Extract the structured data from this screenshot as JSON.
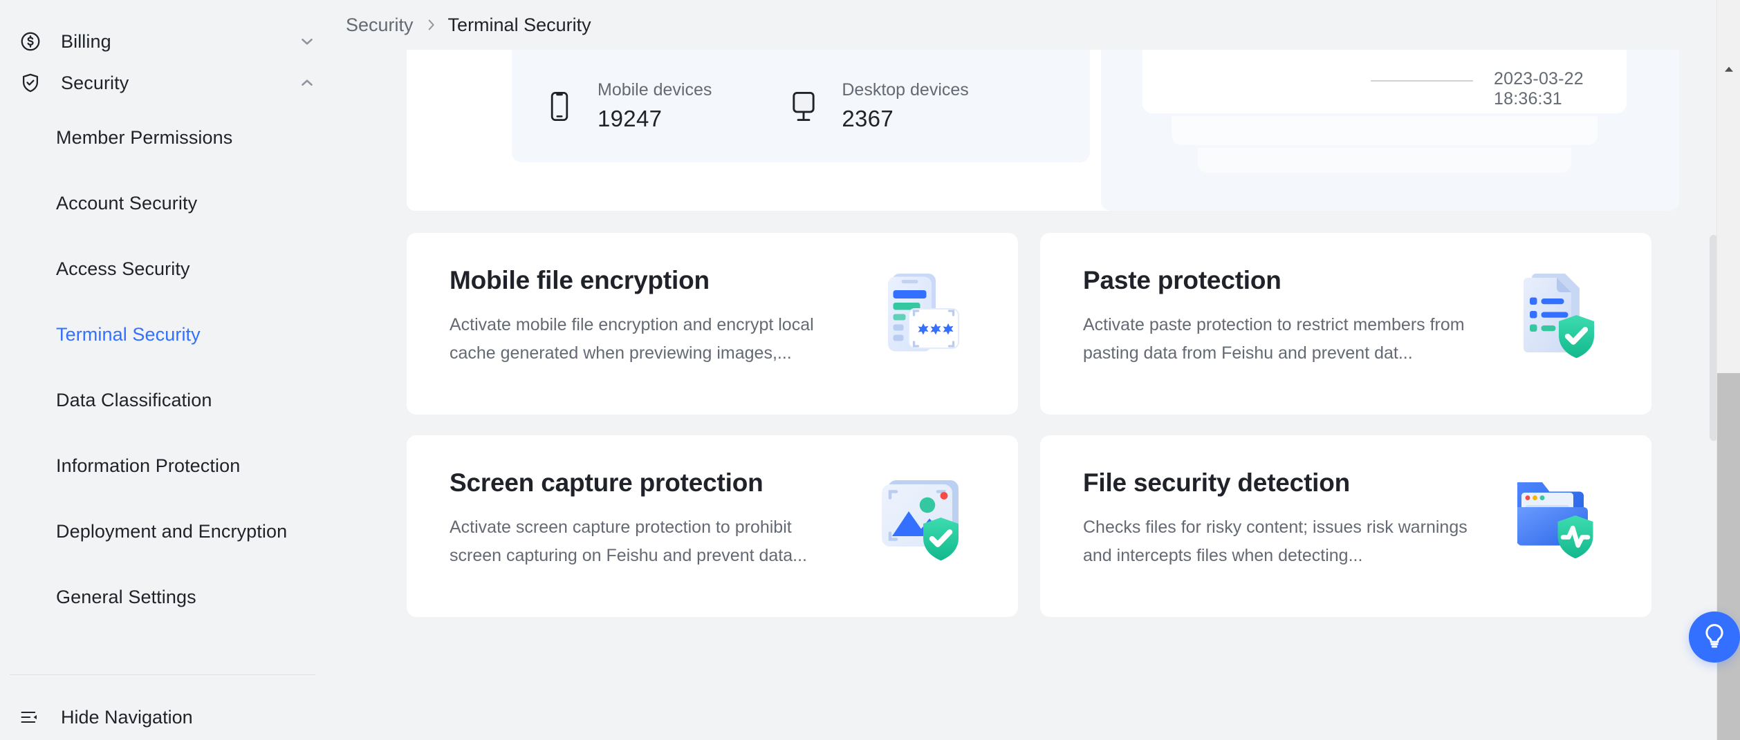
{
  "sidebar": {
    "groups": [
      {
        "label": "Billing",
        "icon": "dollar-circle-icon",
        "expanded": false,
        "chevron": "chevron-down-icon"
      },
      {
        "label": "Security",
        "icon": "shield-check-icon",
        "expanded": true,
        "chevron": "chevron-up-icon"
      }
    ],
    "items": [
      {
        "label": "Member Permissions",
        "active": false
      },
      {
        "label": "Account Security",
        "active": false
      },
      {
        "label": "Access Security",
        "active": false
      },
      {
        "label": "Terminal Security",
        "active": true
      },
      {
        "label": "Data Classification",
        "active": false
      },
      {
        "label": "Information Protection",
        "active": false
      },
      {
        "label": "Deployment and Encryption",
        "active": false
      },
      {
        "label": "General Settings",
        "active": false
      }
    ],
    "hide_navigation": {
      "label": "Hide Navigation",
      "icon": "collapse-panel-icon"
    }
  },
  "breadcrumb": {
    "parent": "Security",
    "separator": "›",
    "current": "Terminal Security"
  },
  "stats": [
    {
      "icon": "mobile-phone-icon",
      "label": "Mobile devices",
      "value": "19247"
    },
    {
      "icon": "desktop-monitor-icon",
      "label": "Desktop devices",
      "value": "2367"
    }
  ],
  "activity_panel": {
    "timestamp": "2023-03-22 18:36:31"
  },
  "feature_cards": [
    {
      "title": "Mobile file encryption",
      "description": "Activate mobile file encryption and encrypt local cache generated when previewing images,...",
      "art": "mobile-encryption-illustration"
    },
    {
      "title": "Paste protection",
      "description": "Activate paste protection to restrict members from pasting data from Feishu and prevent dat...",
      "art": "paste-protection-illustration"
    },
    {
      "title": "Screen capture protection",
      "description": "Activate screen capture protection to prohibit screen capturing on Feishu and prevent data...",
      "art": "screen-capture-illustration"
    },
    {
      "title": "File security detection",
      "description": "Checks files for risky content; issues risk warnings and intercepts files when detecting...",
      "art": "file-detection-illustration"
    }
  ],
  "help_button": {
    "icon": "lightbulb-help-icon"
  },
  "colors": {
    "accent": "#3370ff",
    "page_bg": "#f2f3f5",
    "card_bg": "#ffffff",
    "panel_tint": "#f4f7fb",
    "text_primary": "#1f2329",
    "text_secondary": "#646a73",
    "success": "#34c7a0"
  }
}
